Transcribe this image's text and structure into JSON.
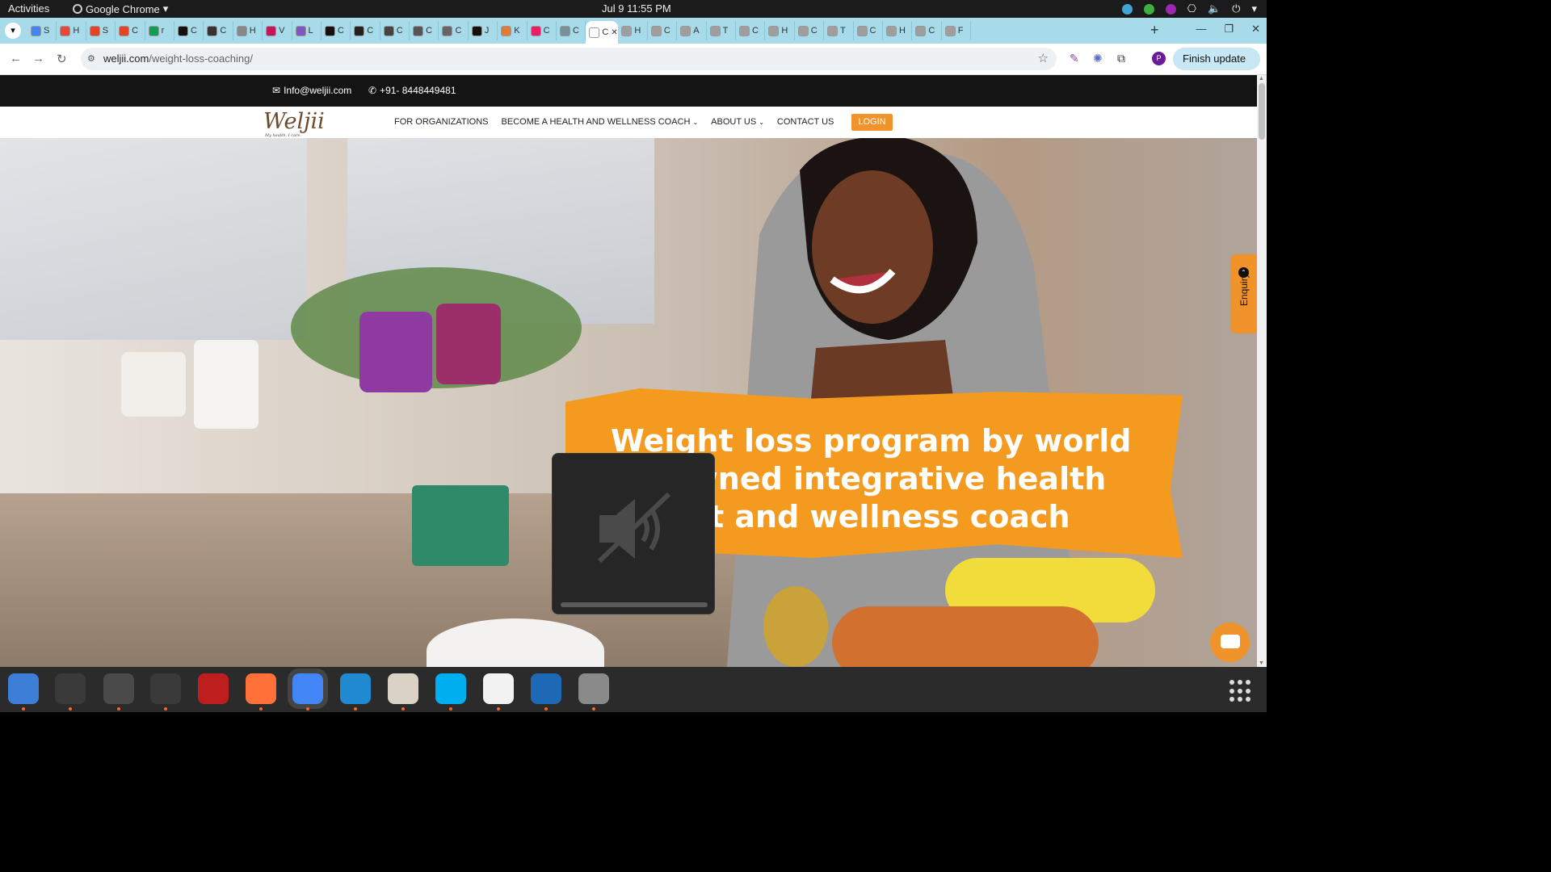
{
  "system_bar": {
    "activities": "Activities",
    "app_name": "Google Chrome",
    "clock": "Jul 9  11:55 PM"
  },
  "tabs": [
    {
      "letter": "S",
      "color": "#4285f4"
    },
    {
      "letter": "H",
      "color": "#e8453c"
    },
    {
      "letter": "S",
      "color": "#e24329"
    },
    {
      "letter": "C",
      "color": "#e24329"
    },
    {
      "letter": "r",
      "color": "#0f9d58"
    },
    {
      "letter": "C",
      "color": "#111111"
    },
    {
      "letter": "C",
      "color": "#333333"
    },
    {
      "letter": "H",
      "color": "#888888"
    },
    {
      "letter": "V",
      "color": "#c2185b"
    },
    {
      "letter": "L",
      "color": "#7e57c2"
    },
    {
      "letter": "C",
      "color": "#111111"
    },
    {
      "letter": "C",
      "color": "#222222"
    },
    {
      "letter": "C",
      "color": "#444444"
    },
    {
      "letter": "C",
      "color": "#555555"
    },
    {
      "letter": "C",
      "color": "#666666"
    },
    {
      "letter": "J",
      "color": "#111111"
    },
    {
      "letter": "K",
      "color": "#e07b39"
    },
    {
      "letter": "C",
      "color": "#e91e63"
    },
    {
      "letter": "C",
      "color": "#78909c"
    },
    {
      "letter": "C",
      "color": "#ffffff",
      "active": true
    },
    {
      "letter": "H",
      "color": "#9e9e9e"
    },
    {
      "letter": "C",
      "color": "#9e9e9e"
    },
    {
      "letter": "A",
      "color": "#9e9e9e"
    },
    {
      "letter": "T",
      "color": "#9e9e9e"
    },
    {
      "letter": "C",
      "color": "#9e9e9e"
    },
    {
      "letter": "H",
      "color": "#9e9e9e"
    },
    {
      "letter": "C",
      "color": "#9e9e9e"
    },
    {
      "letter": "T",
      "color": "#9e9e9e"
    },
    {
      "letter": "C",
      "color": "#9e9e9e"
    },
    {
      "letter": "H",
      "color": "#9e9e9e"
    },
    {
      "letter": "C",
      "color": "#9e9e9e"
    },
    {
      "letter": "F",
      "color": "#9e9e9e"
    }
  ],
  "address_bar": {
    "domain": "weljii.com",
    "path": "/weight-loss-coaching/",
    "finish_update": "Finish update",
    "profile_initial": "P"
  },
  "contact": {
    "email": "Info@weljii.com",
    "phone": "+91- 8448449481"
  },
  "nav": {
    "logo": "Weljii",
    "logo_tagline": "My health. I care.",
    "items": [
      {
        "label": "FOR ORGANIZATIONS",
        "dropdown": false
      },
      {
        "label": "BECOME A HEALTH AND WELLNESS COACH",
        "dropdown": true
      },
      {
        "label": "ABOUT US",
        "dropdown": true
      },
      {
        "label": "CONTACT US",
        "dropdown": false
      }
    ],
    "login": "LOGIN"
  },
  "hero": {
    "headline": "Weight loss program by world renowned integrative health expert and wellness coach"
  },
  "enquiry": "Enquiry",
  "colors": {
    "accent": "#f0932b",
    "tab_strip": "#a7dbe9",
    "contact_bar": "#141414"
  },
  "dock": [
    {
      "name": "thunderbird-icon",
      "color": "#3d7fd6"
    },
    {
      "name": "terminal-icon",
      "color": "#3a3a3a"
    },
    {
      "name": "calculator-icon",
      "color": "#4a4a4a"
    },
    {
      "name": "system-monitor-icon",
      "color": "#3a3a3a"
    },
    {
      "name": "filezilla-icon",
      "color": "#bf1e1e"
    },
    {
      "name": "firefox-icon",
      "color": "#ff7139"
    },
    {
      "name": "chrome-icon",
      "color": "#4285f4"
    },
    {
      "name": "vscode-icon",
      "color": "#1f8ad2"
    },
    {
      "name": "files-icon",
      "color": "#d9d2c5"
    },
    {
      "name": "skype-icon",
      "color": "#00aff0"
    },
    {
      "name": "text-editor-icon",
      "color": "#f2f2f2"
    },
    {
      "name": "writer-icon",
      "color": "#1d69b5"
    },
    {
      "name": "disks-icon",
      "color": "#8a8a8a"
    }
  ]
}
